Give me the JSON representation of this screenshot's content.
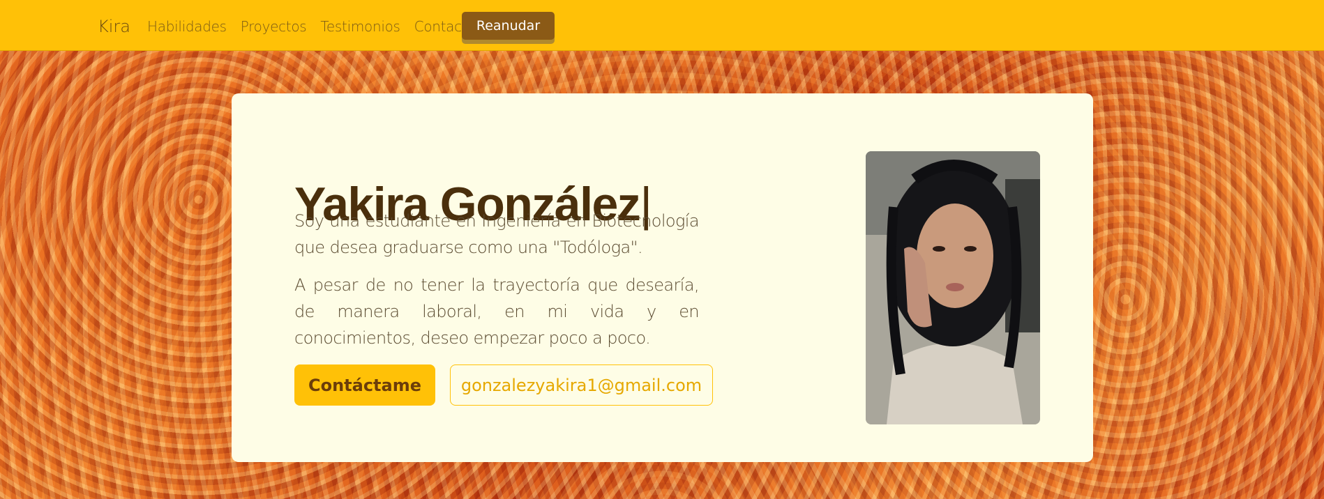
{
  "navbar": {
    "brand": "Kira",
    "links": [
      "Habilidades",
      "Proyectos",
      "Testimonios",
      "Contacto"
    ],
    "resume_label": "Reanudar"
  },
  "hero": {
    "name": "Yakira González",
    "cursor": "|",
    "paragraph_1": "Soy una estudiante en Ingeniería en Biotecnología que desea graduarse como una \"Todóloga\".",
    "paragraph_2": "A pesar de no tener la trayectoría que desearía, de manera laboral, en mi vida y en conocimientos, deseo empezar poco a poco.",
    "contact_label": "Contáctame",
    "email": "gonzalezyakira1@gmail.com"
  },
  "colors": {
    "navbar": "#ffc107",
    "card": "#fefde6",
    "title": "#4a2f0c",
    "resume_button": "#8b5a16"
  }
}
